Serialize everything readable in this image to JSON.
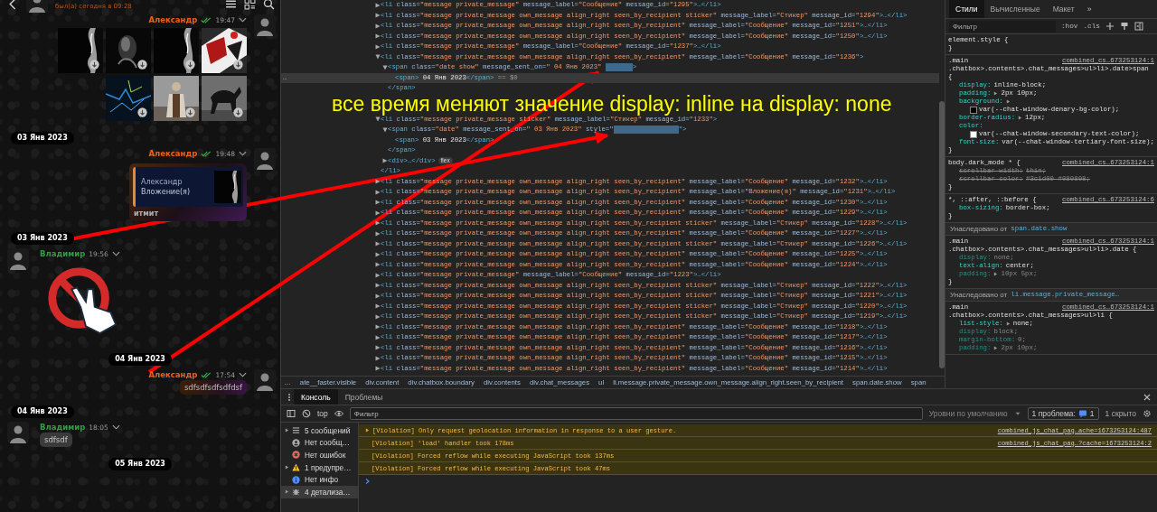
{
  "chat": {
    "header": {
      "status": "был(а) сегодня в 09:28"
    },
    "items": [
      {
        "kind": "message",
        "own": true,
        "author": "Александр",
        "time": "19:47",
        "read": true,
        "content": {
          "kind": "images"
        }
      },
      {
        "kind": "date",
        "text": "03 Янв 2023",
        "centered": false
      },
      {
        "kind": "message",
        "own": true,
        "author": "Александр",
        "time": "19:48",
        "read": true,
        "content": {
          "kind": "reply",
          "quote_author": "Александр",
          "quote_text": "Вложение(я)",
          "text": "итмит"
        }
      },
      {
        "kind": "date",
        "text": "03 Янв 2023",
        "centered": false
      },
      {
        "kind": "message",
        "own": false,
        "author": "Владимир",
        "time": "19:56",
        "content": {
          "kind": "sticker"
        }
      },
      {
        "kind": "date",
        "text": "04 Янв 2023",
        "centered": true
      },
      {
        "kind": "message",
        "own": true,
        "author": "Александр",
        "time": "17:54",
        "read": true,
        "content": {
          "kind": "text",
          "text": "sdfsdfsdfsdfdsf"
        }
      },
      {
        "kind": "date",
        "text": "04 Янв 2023",
        "centered": false
      },
      {
        "kind": "message",
        "own": false,
        "author": "Владимир",
        "time": "18:05",
        "content": {
          "kind": "text",
          "text": "sdfsdf"
        }
      },
      {
        "kind": "date",
        "text": "05 Янв 2023",
        "centered": true
      }
    ]
  },
  "elements": {
    "tree": [
      {
        "kind": "element",
        "open": "<li",
        "attrs": [
          {
            "name": "class=",
            "value": "\"message private_message\""
          },
          {
            "name": "message_label=",
            "value": "\"Сообщение\""
          },
          {
            "name": "message_id=",
            "value": "\"1295\""
          }
        ],
        "tail": ">…</li>",
        "expanded": false
      },
      {
        "kind": "element",
        "open": "<li",
        "attrs": [
          {
            "name": "class=",
            "value": "\"message private_message own_message align_right seen_by_recipient sticker\""
          },
          {
            "name": "message_label=",
            "value": "\"Стикер\""
          },
          {
            "name": "message_id=",
            "value": "\"1294\""
          }
        ],
        "tail": ">…</li>",
        "expanded": false
      },
      {
        "kind": "element",
        "open": "<li",
        "attrs": [
          {
            "name": "class=",
            "value": "\"message private_message own_message align_right seen_by_recipient\""
          },
          {
            "name": "message_label=",
            "value": "\"Сообщение\""
          },
          {
            "name": "message_id=",
            "value": "\"1251\""
          }
        ],
        "tail": ">…</li>",
        "expanded": false
      },
      {
        "kind": "element",
        "open": "<li",
        "attrs": [
          {
            "name": "class=",
            "value": "\"message private_message own_message align_right seen_by_recipient\""
          },
          {
            "name": "message_label=",
            "value": "\"Сообщение\""
          },
          {
            "name": "message_id=",
            "value": "\"1250\""
          }
        ],
        "tail": ">…</li>",
        "expanded": false
      },
      {
        "kind": "element",
        "open": "<li",
        "attrs": [
          {
            "name": "class=",
            "value": "\"message private_message\""
          },
          {
            "name": "message_label=",
            "value": "\"Сообщение\""
          },
          {
            "name": "message_id=",
            "value": "\"1237\""
          }
        ],
        "tail": ">…</li>",
        "expanded": false
      },
      {
        "kind": "element",
        "open": "<li",
        "attrs": [
          {
            "name": "class=",
            "value": "\"message private_message own_message align_right seen_by_recipient\""
          },
          {
            "name": "message_label=",
            "value": "\"Сообщение\""
          },
          {
            "name": "message_id=",
            "value": "\"1236\""
          }
        ],
        "tail": ">",
        "expanded": true,
        "children": [
          {
            "kind": "element",
            "open": "<span",
            "attrs": [
              {
                "name": "class=",
                "value": "\"date show\""
              },
              {
                "name": "message_sent_on=",
                "value": "\" 04 Янв 2023\""
              },
              {
                "masked": true
              }
            ],
            "tail": ">",
            "expanded": true,
            "close": "</span>",
            "children": [
              {
                "kind": "inline",
                "open": "<span>",
                "text": " 04 Янв 2023",
                "close": "</span>",
                "ref": "== $0",
                "marker": "…",
                "selected": true
              }
            ]
          }
        ]
      },
      {
        "kind": "note",
        "text": "все время меняют значение display: inline на display: none"
      },
      {
        "kind": "element",
        "open": "<li",
        "attrs": [
          {
            "name": "class=",
            "value": "\"message private_message sticker\""
          },
          {
            "name": "message_label=",
            "value": "\"Стикер\""
          },
          {
            "name": "message_id=",
            "value": "\"1233\""
          }
        ],
        "tail": ">",
        "expanded": true,
        "close": "</li>",
        "children": [
          {
            "kind": "element",
            "open": "<span",
            "attrs": [
              {
                "name": "class=",
                "value": "\"date\""
              },
              {
                "name": "message_sent_on=",
                "value": "\" 03 Янв 2023\""
              },
              {
                "name": "style=\"",
                "masked": true
              }
            ],
            "tail": "\">",
            "expanded": true,
            "close": "</span>",
            "children": [
              {
                "kind": "inline",
                "open": "<span>",
                "text": " 03 Янв 2023",
                "close": "</span>",
                "selected": false
              }
            ]
          },
          {
            "kind": "element",
            "open": "<div",
            "tail": ">…</div>",
            "expanded": false,
            "badge": "flex"
          }
        ]
      },
      {
        "kind": "element",
        "open": "<li",
        "attrs": [
          {
            "name": "class=",
            "value": "\"message private_message own_message align_right seen_by_recipient\""
          },
          {
            "name": "message_label=",
            "value": "\"Сообщение\""
          },
          {
            "name": "message_id=",
            "value": "\"1232\""
          }
        ],
        "tail": ">…</li>",
        "expanded": false
      },
      {
        "kind": "element",
        "open": "<li",
        "attrs": [
          {
            "name": "class=",
            "value": "\"message private_message own_message align_right seen_by_recipient\""
          },
          {
            "name": "message_label=",
            "value": "\"Вложение(я)\""
          },
          {
            "name": "message_id=",
            "value": "\"1231\""
          }
        ],
        "tail": ">…</li>",
        "expanded": false
      },
      {
        "kind": "element",
        "open": "<li",
        "attrs": [
          {
            "name": "class=",
            "value": "\"message private_message own_message align_right seen_by_recipient\""
          },
          {
            "name": "message_label=",
            "value": "\"Сообщение\""
          },
          {
            "name": "message_id=",
            "value": "\"1230\""
          }
        ],
        "tail": ">…</li>",
        "expanded": false
      },
      {
        "kind": "element",
        "open": "<li",
        "attrs": [
          {
            "name": "class=",
            "value": "\"message private_message own_message align_right seen_by_recipient\""
          },
          {
            "name": "message_label=",
            "value": "\"Сообщение\""
          },
          {
            "name": "message_id=",
            "value": "\"1229\""
          }
        ],
        "tail": ">…</li>",
        "expanded": false
      },
      {
        "kind": "element",
        "open": "<li",
        "attrs": [
          {
            "name": "class=",
            "value": "\"message private_message own_message align_right seen_by_recipient sticker\""
          },
          {
            "name": "message_label=",
            "value": "\"Стикер\""
          },
          {
            "name": "message_id=",
            "value": "\"1228\""
          }
        ],
        "tail": ">…</li>",
        "expanded": false
      },
      {
        "kind": "element",
        "open": "<li",
        "attrs": [
          {
            "name": "class=",
            "value": "\"message private_message own_message align_right seen_by_recipient\""
          },
          {
            "name": "message_label=",
            "value": "\"Сообщение\""
          },
          {
            "name": "message_id=",
            "value": "\"1227\""
          }
        ],
        "tail": ">…</li>",
        "expanded": false
      },
      {
        "kind": "element",
        "open": "<li",
        "attrs": [
          {
            "name": "class=",
            "value": "\"message private_message own_message align_right seen_by_recipient sticker\""
          },
          {
            "name": "message_label=",
            "value": "\"Стикер\""
          },
          {
            "name": "message_id=",
            "value": "\"1226\""
          }
        ],
        "tail": ">…</li>",
        "expanded": false
      },
      {
        "kind": "element",
        "open": "<li",
        "attrs": [
          {
            "name": "class=",
            "value": "\"message private_message own_message align_right seen_by_recipient\""
          },
          {
            "name": "message_label=",
            "value": "\"Сообщение\""
          },
          {
            "name": "message_id=",
            "value": "\"1225\""
          }
        ],
        "tail": ">…</li>",
        "expanded": false
      },
      {
        "kind": "element",
        "open": "<li",
        "attrs": [
          {
            "name": "class=",
            "value": "\"message private_message own_message align_right seen_by_recipient\""
          },
          {
            "name": "message_label=",
            "value": "\"Сообщение\""
          },
          {
            "name": "message_id=",
            "value": "\"1224\""
          }
        ],
        "tail": ">…</li>",
        "expanded": false
      },
      {
        "kind": "element",
        "open": "<li",
        "attrs": [
          {
            "name": "class=",
            "value": "\"message private_message\""
          },
          {
            "name": "message_label=",
            "value": "\"Сообщение\""
          },
          {
            "name": "message_id=",
            "value": "\"1223\""
          }
        ],
        "tail": ">…</li>",
        "expanded": false
      },
      {
        "kind": "element",
        "open": "<li",
        "attrs": [
          {
            "name": "class=",
            "value": "\"message private_message own_message align_right seen_by_recipient sticker\""
          },
          {
            "name": "message_label=",
            "value": "\"Стикер\""
          },
          {
            "name": "message_id=",
            "value": "\"1222\""
          }
        ],
        "tail": ">…</li>",
        "expanded": false
      },
      {
        "kind": "element",
        "open": "<li",
        "attrs": [
          {
            "name": "class=",
            "value": "\"message private_message own_message align_right seen_by_recipient sticker\""
          },
          {
            "name": "message_label=",
            "value": "\"Стикер\""
          },
          {
            "name": "message_id=",
            "value": "\"1221\""
          }
        ],
        "tail": ">…</li>",
        "expanded": false
      },
      {
        "kind": "element",
        "open": "<li",
        "attrs": [
          {
            "name": "class=",
            "value": "\"message private_message own_message align_right seen_by_recipient sticker\""
          },
          {
            "name": "message_label=",
            "value": "\"Стикер\""
          },
          {
            "name": "message_id=",
            "value": "\"1220\""
          }
        ],
        "tail": ">…</li>",
        "expanded": false
      },
      {
        "kind": "element",
        "open": "<li",
        "attrs": [
          {
            "name": "class=",
            "value": "\"message private_message own_message align_right seen_by_recipient sticker\""
          },
          {
            "name": "message_label=",
            "value": "\"Стикер\""
          },
          {
            "name": "message_id=",
            "value": "\"1219\""
          }
        ],
        "tail": ">…</li>",
        "expanded": false
      },
      {
        "kind": "element",
        "open": "<li",
        "attrs": [
          {
            "name": "class=",
            "value": "\"message private_message own_message align_right seen_by_recipient\""
          },
          {
            "name": "message_label=",
            "value": "\"Сообщение\""
          },
          {
            "name": "message_id=",
            "value": "\"1218\""
          }
        ],
        "tail": ">…</li>",
        "expanded": false
      },
      {
        "kind": "element",
        "open": "<li",
        "attrs": [
          {
            "name": "class=",
            "value": "\"message private_message own_message align_right seen_by_recipient\""
          },
          {
            "name": "message_label=",
            "value": "\"Сообщение\""
          },
          {
            "name": "message_id=",
            "value": "\"1217\""
          }
        ],
        "tail": ">…</li>",
        "expanded": false
      },
      {
        "kind": "element",
        "open": "<li",
        "attrs": [
          {
            "name": "class=",
            "value": "\"message private_message own_message align_right seen_by_recipient\""
          },
          {
            "name": "message_label=",
            "value": "\"Сообщение\""
          },
          {
            "name": "message_id=",
            "value": "\"1216\""
          }
        ],
        "tail": ">…</li>",
        "expanded": false
      },
      {
        "kind": "element",
        "open": "<li",
        "attrs": [
          {
            "name": "class=",
            "value": "\"message private_message own_message align_right seen_by_recipient\""
          },
          {
            "name": "message_label=",
            "value": "\"Сообщение\""
          },
          {
            "name": "message_id=",
            "value": "\"1215\""
          }
        ],
        "tail": ">…</li>",
        "expanded": false
      },
      {
        "kind": "element",
        "open": "<li",
        "attrs": [
          {
            "name": "class=",
            "value": "\"message private_message own_message align_right seen_by_recipient\""
          },
          {
            "name": "message_label=",
            "value": "\"Сообщение\""
          },
          {
            "name": "message_id=",
            "value": "\"1214\""
          }
        ],
        "tail": ">…</li>",
        "expanded": false
      }
    ],
    "breadcrumbs": [
      "…",
      "ate__faster.visible",
      "div.content",
      "div.chatbox.boundary",
      "div.contents",
      "div.chat_messages",
      "ul",
      "li.message.private_message.own_message.align_right.seen_by_recipient",
      "span.date.show",
      "span"
    ]
  },
  "styles": {
    "tabs": [
      {
        "label": "Стили",
        "selected": true
      },
      {
        "label": "Вычисленные",
        "selected": false
      },
      {
        "label": "Макет",
        "selected": false
      }
    ],
    "more": "»",
    "filter": {
      "placeholder": "Фильтр"
    },
    "toggles": [
      ":hov",
      ".cls"
    ],
    "rules": [
      {
        "kind": "rule",
        "selector": [
          "element.style {"
        ],
        "close": "}"
      },
      {
        "kind": "rule",
        "selector": [
          ".main",
          ".chatbox>.contents>.chat_messages>ul>li>.date>span",
          "{"
        ],
        "source": "combined_cs…673253124:1",
        "props": [
          {
            "name": "display:",
            "value": "inline-block;"
          },
          {
            "name": "padding:",
            "value": "2px 10px;",
            "expandable": true
          },
          {
            "name": "background:",
            "value": "var(--chat-window-denary-bg-color);",
            "expandable": true,
            "color": "#000000"
          },
          {
            "name": "border-radius:",
            "value": "12px;",
            "expandable": true
          },
          {
            "name": "color:",
            "value": "var(--chat-window-secondary-text-color);",
            "color": "#ffffff"
          },
          {
            "name": "font-size:",
            "value": "var(--chat-window-tertiary-font-size);"
          }
        ],
        "close": "}"
      },
      {
        "kind": "rule",
        "selector": [
          "body.dark_mode * {"
        ],
        "source": "combined_cs…673253124:1",
        "props": [
          {
            "name": "scrollbar-width:",
            "value": "thin;",
            "struck": true
          },
          {
            "name": "scrollbar-color:",
            "value": "#3c1d00 #080808;",
            "struck": true
          }
        ],
        "close": "}"
      },
      {
        "kind": "rule",
        "selector": [
          "*, ::after, ::before {"
        ],
        "source": "combined_cs…673253124:6",
        "props": [
          {
            "name": "box-sizing:",
            "value": "border-box;"
          }
        ],
        "close": "}"
      },
      {
        "kind": "inherited",
        "label": "Унаследовано от",
        "link": "span.date.show"
      },
      {
        "kind": "rule",
        "selector": [
          ".main",
          ".chatbox>.contents>.chat_messages>ul>li>.date {"
        ],
        "source": "combined_cs…673253124:1",
        "props": [
          {
            "name": "display:",
            "value": "none;",
            "inactive": true
          },
          {
            "name": "text-align:",
            "value": "center;"
          },
          {
            "name": "padding:",
            "value": "10px 5px;",
            "expandable": true,
            "inactive": true
          }
        ],
        "close": "}"
      },
      {
        "kind": "inherited",
        "label": "Унаследовано от",
        "link": "li.message.private_message…"
      },
      {
        "kind": "rule",
        "selector": [
          ".main",
          ".chatbox>.contents>.chat_messages>ul>li {"
        ],
        "source": "combined_cs…673253124:1",
        "props": [
          {
            "name": "list-style:",
            "value": "none;",
            "expandable": true
          },
          {
            "name": "display:",
            "value": "block;",
            "inactive": true
          },
          {
            "name": "margin-bottom:",
            "value": "0;",
            "inactive": true
          },
          {
            "name": "padding:",
            "value": "2px 10px;",
            "expandable": true,
            "inactive": true
          }
        ]
      }
    ]
  },
  "console": {
    "tabs": [
      {
        "label": "Консоль",
        "selected": true
      },
      {
        "label": "Проблемы",
        "selected": false
      }
    ],
    "context": "top",
    "filter": {
      "placeholder": "Фильтр"
    },
    "levels": "Уровни по умолчанию",
    "issues": {
      "label": "1 проблема:",
      "count": "1"
    },
    "hidden": "1 скрыто",
    "sidebar": [
      {
        "kind": "messages",
        "label": "5 сообщений",
        "expandable": true,
        "selected": false
      },
      {
        "kind": "user",
        "label": "Нет сообщ…",
        "expandable": false,
        "selected": false
      },
      {
        "kind": "error",
        "label": "Нет ошибок",
        "expandable": false,
        "selected": false
      },
      {
        "kind": "warning",
        "label": "1 предупре…",
        "expandable": true,
        "selected": false
      },
      {
        "kind": "info",
        "label": "Нет инфо",
        "expandable": false,
        "selected": false
      },
      {
        "kind": "verbose",
        "label": "4 детализа…",
        "expandable": true,
        "selected": true
      }
    ],
    "messages": [
      {
        "text": "[Violation] Only request geolocation information in response to a user gesture.",
        "expandable": true,
        "source": "combined_js_chat_pag…ache=1673253124:487"
      },
      {
        "text": "[Violation] 'load' handler took 178ms",
        "expandable": false,
        "source": "combined_js_chat_pag…?cache=1673253124:2"
      },
      {
        "text": "[Violation] Forced reflow while executing JavaScript took 137ms",
        "expandable": false
      },
      {
        "text": "[Violation] Forced reflow while executing JavaScript took 47ms",
        "expandable": false
      }
    ]
  }
}
